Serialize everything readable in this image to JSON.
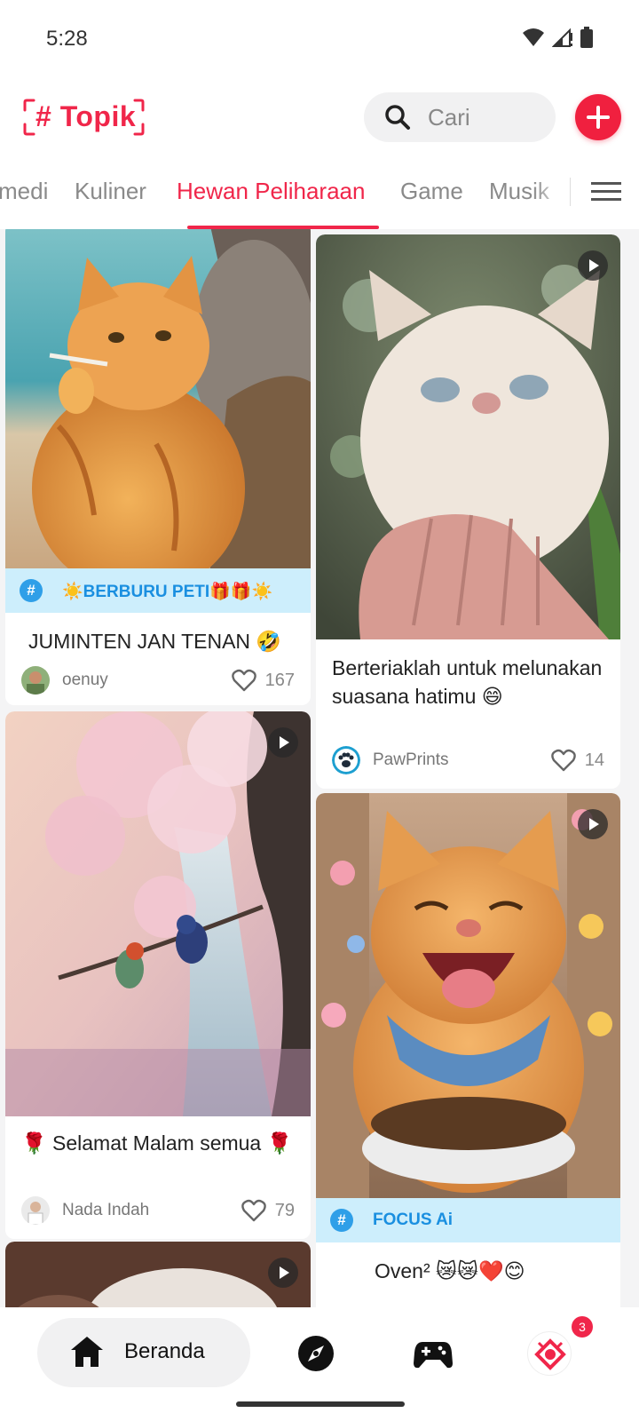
{
  "status_bar": {
    "time": "5:28"
  },
  "header": {
    "logo_text": "# Topik",
    "search_placeholder": "Cari"
  },
  "tabs": [
    {
      "label": "medi"
    },
    {
      "label": "Kuliner"
    },
    {
      "label": "Hewan Peliharaan"
    },
    {
      "label": "Game"
    },
    {
      "label": "Musik"
    }
  ],
  "active_tab": "Hewan Peliharaan",
  "feed": {
    "left": [
      {
        "topic": "☀️BERBURU PETI🎁🎁☀️",
        "title": "JUMINTEN JAN TENAN 🤣",
        "author": "oenuy",
        "likes": "167",
        "video": false
      },
      {
        "title": "🌹 Selamat Malam semua 🌹",
        "author": "Nada Indah",
        "likes": "79",
        "video": true
      }
    ],
    "right": [
      {
        "title": "Berteriaklah untuk melunakan suasana hatimu 😄",
        "author": "PawPrints",
        "likes": "14",
        "video": true
      },
      {
        "topic": "FOCUS Ai",
        "title": "Oven² 😿😿❤️😊",
        "video": true
      }
    ]
  },
  "bottom_nav": {
    "home_label": "Beranda",
    "badge_count": "3"
  },
  "colors": {
    "accent": "#f0264a",
    "topic_bg": "#cdeefc",
    "topic_text": "#1a8fe0"
  }
}
